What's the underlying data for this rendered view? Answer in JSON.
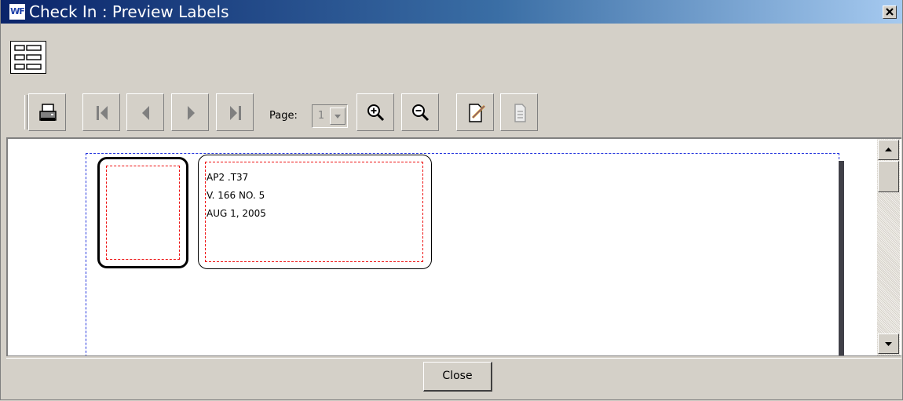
{
  "window": {
    "title": "Check In : Preview Labels",
    "app_icon_text": "WF",
    "close_glyph": "✕"
  },
  "toolbar": {
    "page_label": "Page:",
    "page_value": "1",
    "buttons": [
      "printer-icon",
      "first-page-icon",
      "previous-page-icon",
      "next-page-icon",
      "last-page-icon",
      "zoom-in-icon",
      "zoom-out-icon",
      "edit-document-icon",
      "document-icon"
    ]
  },
  "labels": [
    {
      "lines": []
    },
    {
      "lines": [
        "AP2 .T37",
        "V. 166 NO. 5",
        "AUG 1, 2005"
      ]
    }
  ],
  "footer": {
    "close_label": "Close"
  }
}
